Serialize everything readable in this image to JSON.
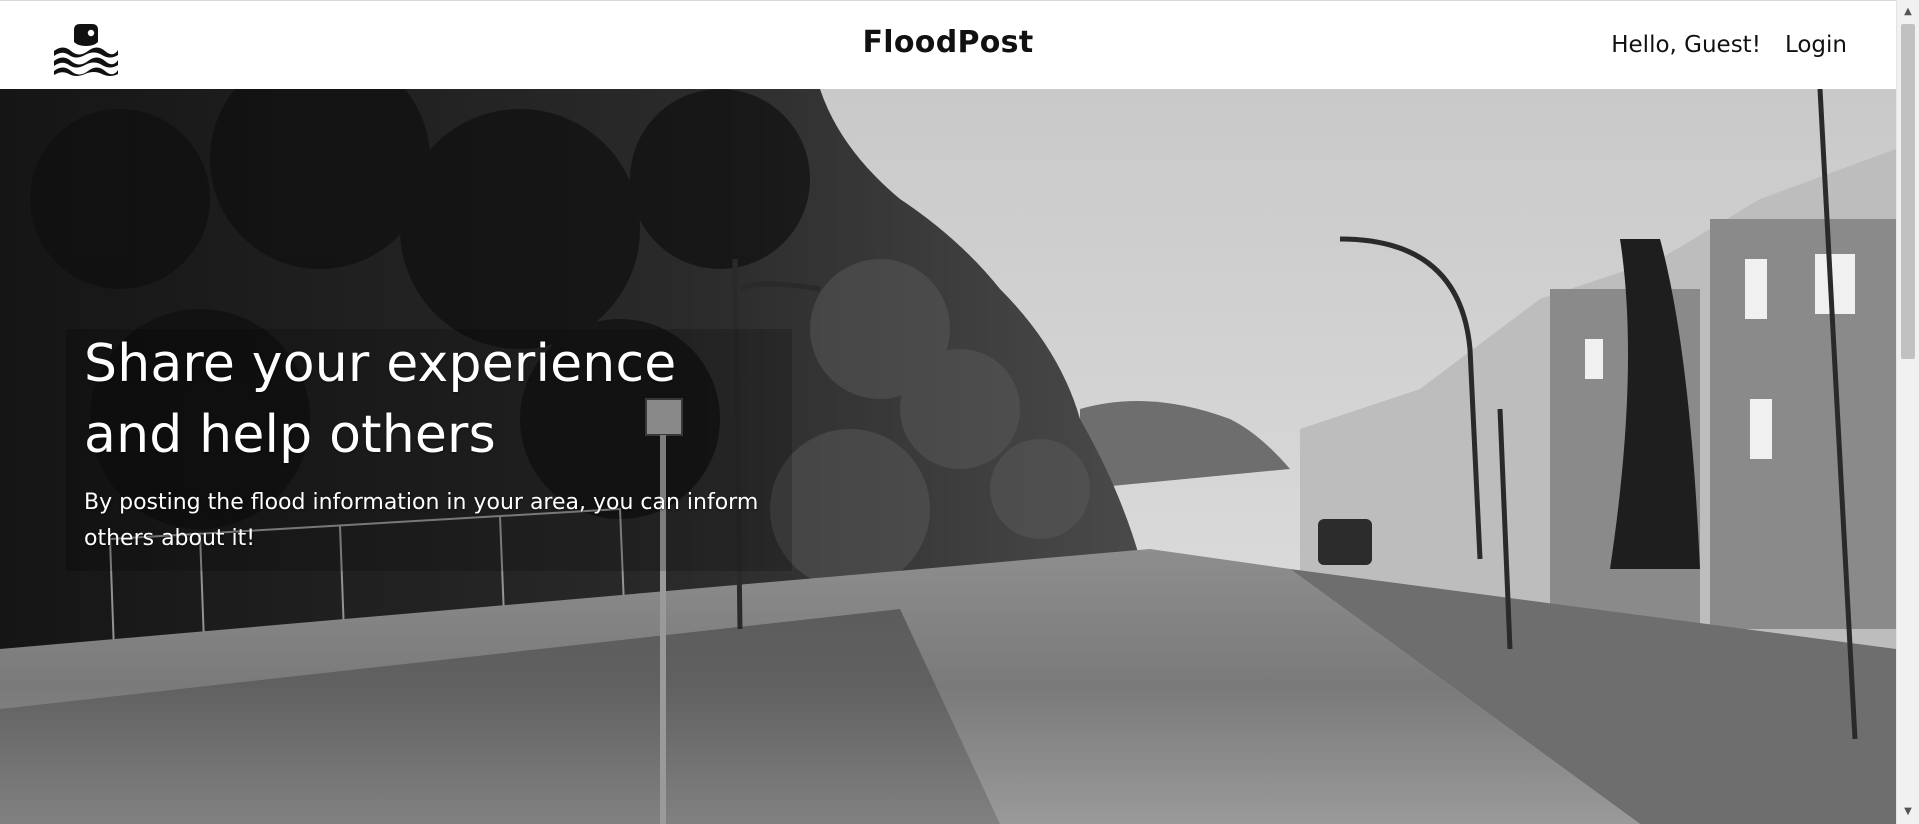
{
  "header": {
    "brand": "FloodPost",
    "greeting": "Hello, Guest!",
    "login_label": "Login",
    "logo_icon": "flood-wave-icon"
  },
  "hero": {
    "title": "Share your experience and help others",
    "subtitle": "By posting the flood information in your area, you can inform others about it!",
    "background_image": "flooded-street-photo",
    "colors": {
      "overlay": "#000000",
      "text": "#ffffff"
    }
  },
  "scrollbar": {
    "up_icon": "scroll-up-arrow-icon",
    "down_icon": "scroll-down-arrow-icon"
  }
}
